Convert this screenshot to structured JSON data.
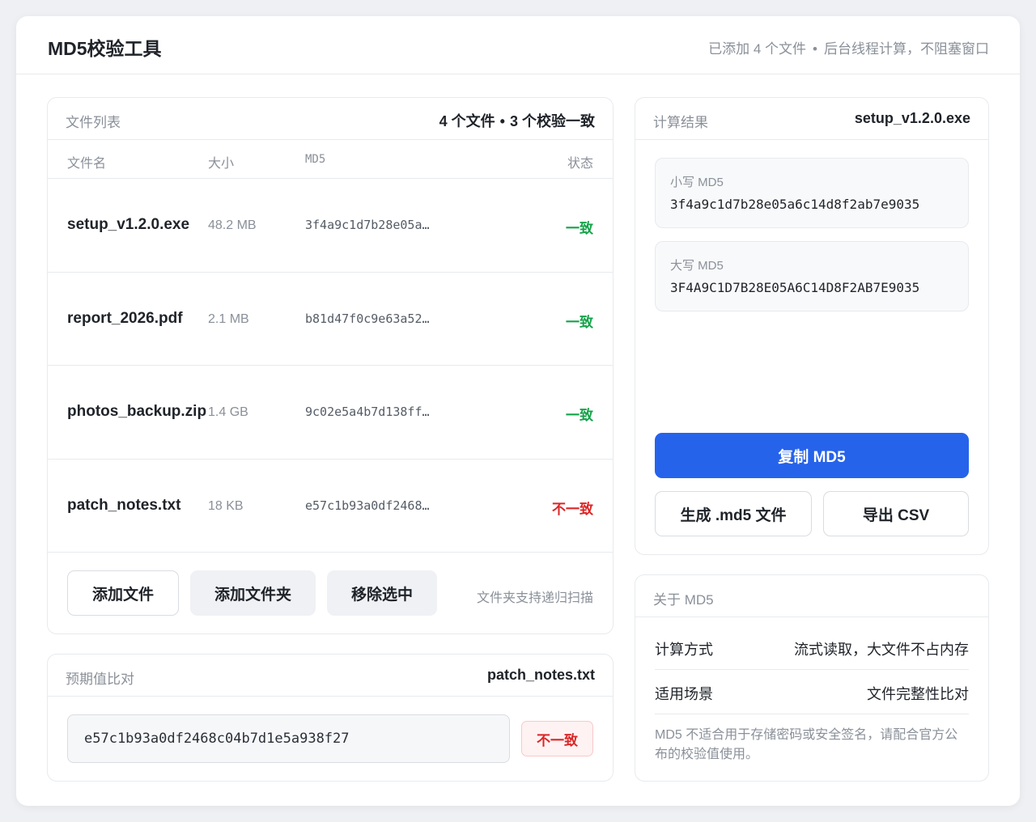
{
  "app": {
    "title": "MD5校验工具",
    "status_left": "已添加 4 个文件",
    "status_sep": "•",
    "status_right": "后台线程计算，不阻塞窗口"
  },
  "file_list": {
    "label": "文件列表",
    "summary_count": "4 个文件",
    "summary_sep": "•",
    "summary_match": "3 个校验一致",
    "columns": [
      "文件名",
      "大小",
      "MD5",
      "状态"
    ],
    "rows": [
      {
        "name": "setup_v1.2.0.exe",
        "size": "48.2 MB",
        "md5": "3f4a9c1d7b28e05a…",
        "status": "一致",
        "status_type": "ok"
      },
      {
        "name": "report_2026.pdf",
        "size": "2.1 MB",
        "md5": "b81d47f0c9e63a52…",
        "status": "一致",
        "status_type": "ok"
      },
      {
        "name": "photos_backup.zip",
        "size": "1.4 GB",
        "md5": "9c02e5a4b7d138ff…",
        "status": "一致",
        "status_type": "ok"
      },
      {
        "name": "patch_notes.txt",
        "size": "18 KB",
        "md5": "e57c1b93a0df2468…",
        "status": "不一致",
        "status_type": "bad"
      }
    ],
    "buttons": {
      "add_file": "添加文件",
      "add_folder": "添加文件夹",
      "remove_selected": "移除选中"
    },
    "hint": "文件夹支持递归扫描"
  },
  "compare": {
    "label": "预期值比对",
    "file": "patch_notes.txt",
    "input_value": "e57c1b93a0df2468c04b7d1e5a938f27",
    "result": "不一致"
  },
  "result": {
    "label": "计算结果",
    "file": "setup_v1.2.0.exe",
    "lower_label": "小写 MD5",
    "lower_value": "3f4a9c1d7b28e05a6c14d8f2ab7e9035",
    "upper_label": "大写 MD5",
    "upper_value": "3F4A9C1D7B28E05A6C14D8F2AB7E9035",
    "copy_button": "复制 MD5",
    "gen_button": "生成 .md5 文件",
    "export_button": "导出 CSV"
  },
  "about": {
    "label": "关于 MD5",
    "rows": [
      {
        "key": "计算方式",
        "value": "流式读取，大文件不占内存"
      },
      {
        "key": "适用场景",
        "value": "文件完整性比对"
      }
    ],
    "note": "MD5 不适合用于存储密码或安全签名，请配合官方公布的校验值使用。"
  },
  "colors": {
    "accent": "#2563eb",
    "ok": "#16a34a",
    "bad": "#dc2626"
  }
}
